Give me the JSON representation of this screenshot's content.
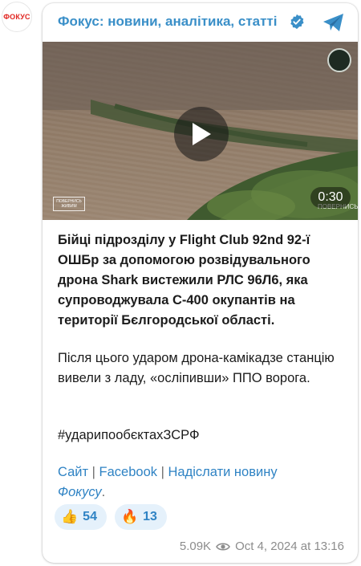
{
  "avatar": {
    "text": "ФОКУС"
  },
  "header": {
    "channel_title": "Фокус: новини, аналітика, статті"
  },
  "video": {
    "duration": "0:30",
    "logo_text": "ПОВЕРНИСЬ ЖИВИМ",
    "watermark_text": "ПОВЕРНИСЬ"
  },
  "message": {
    "bold_text": "Бійці підрозділу у Flight Club 92nd 92-ї ОШБр за допомогою розвідувального дрона Shark вистежили РЛС 96Л6, яка супроводжувала С-400 окупантів на території Бєлгородської області.",
    "paragraph2": "Після цього ударом дрона-камікадзе станцію вивели з ладу, «осліпивши» ППО ворога.",
    "hashtag": "#ударипообєктахЗСРФ"
  },
  "links": {
    "site": "Сайт",
    "separator": "|",
    "facebook": "Facebook",
    "send_news": "Надіслати новину",
    "fokus": "Фокусу",
    "period": "."
  },
  "reactions": [
    {
      "emoji": "👍",
      "count": "54"
    },
    {
      "emoji": "🔥",
      "count": "13"
    }
  ],
  "footer": {
    "views": "5.09K",
    "date": "Oct 4, 2024 at 13:16"
  },
  "colors": {
    "accent": "#3a8fc8",
    "link": "#2f83c4",
    "reaction_bg": "#e5f1fb",
    "brand_red": "#e0241f"
  }
}
